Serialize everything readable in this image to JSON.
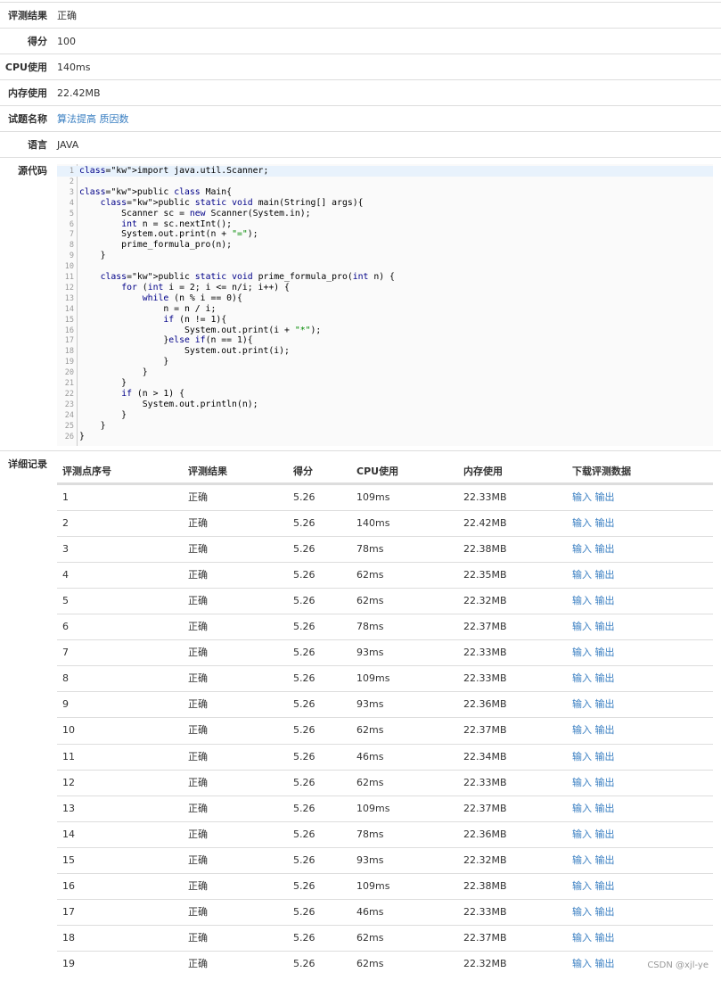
{
  "summary": [
    {
      "label": "评测结果",
      "value": "正确",
      "link": false
    },
    {
      "label": "得分",
      "value": "100",
      "link": false
    },
    {
      "label": "CPU使用",
      "value": "140ms",
      "link": false
    },
    {
      "label": "内存使用",
      "value": "22.42MB",
      "link": false
    },
    {
      "label": "试题名称",
      "value": "算法提高 质因数",
      "link": true
    },
    {
      "label": "语言",
      "value": "JAVA",
      "link": false
    }
  ],
  "source": {
    "label": "源代码",
    "lines": [
      "import java.util.Scanner;",
      "",
      "public class Main{",
      "    public static void main(String[] args){",
      "        Scanner sc = new Scanner(System.in);",
      "        int n = sc.nextInt();",
      "        System.out.print(n + \"=\");",
      "        prime_formula_pro(n);",
      "    }",
      "",
      "    public static void prime_formula_pro(int n) {",
      "        for (int i = 2; i <= n/i; i++) {",
      "            while (n % i == 0){",
      "                n = n / i;",
      "                if (n != 1){",
      "                    System.out.print(i + \"*\");",
      "                }else if(n == 1){",
      "                    System.out.print(i);",
      "                }",
      "            }",
      "        }",
      "        if (n > 1) {",
      "            System.out.println(n);",
      "        }",
      "    }",
      "}"
    ]
  },
  "details": {
    "label": "详细记录",
    "headers": [
      "评测点序号",
      "评测结果",
      "得分",
      "CPU使用",
      "内存使用",
      "下载评测数据"
    ],
    "download_input": "输入",
    "download_output": "输出",
    "rows": [
      [
        "1",
        "正确",
        "5.26",
        "109ms",
        "22.33MB"
      ],
      [
        "2",
        "正确",
        "5.26",
        "140ms",
        "22.42MB"
      ],
      [
        "3",
        "正确",
        "5.26",
        "78ms",
        "22.38MB"
      ],
      [
        "4",
        "正确",
        "5.26",
        "62ms",
        "22.35MB"
      ],
      [
        "5",
        "正确",
        "5.26",
        "62ms",
        "22.32MB"
      ],
      [
        "6",
        "正确",
        "5.26",
        "78ms",
        "22.37MB"
      ],
      [
        "7",
        "正确",
        "5.26",
        "93ms",
        "22.33MB"
      ],
      [
        "8",
        "正确",
        "5.26",
        "109ms",
        "22.33MB"
      ],
      [
        "9",
        "正确",
        "5.26",
        "93ms",
        "22.36MB"
      ],
      [
        "10",
        "正确",
        "5.26",
        "62ms",
        "22.37MB"
      ],
      [
        "11",
        "正确",
        "5.26",
        "46ms",
        "22.34MB"
      ],
      [
        "12",
        "正确",
        "5.26",
        "62ms",
        "22.33MB"
      ],
      [
        "13",
        "正确",
        "5.26",
        "109ms",
        "22.37MB"
      ],
      [
        "14",
        "正确",
        "5.26",
        "78ms",
        "22.36MB"
      ],
      [
        "15",
        "正确",
        "5.26",
        "93ms",
        "22.32MB"
      ],
      [
        "16",
        "正确",
        "5.26",
        "109ms",
        "22.38MB"
      ],
      [
        "17",
        "正确",
        "5.26",
        "46ms",
        "22.33MB"
      ],
      [
        "18",
        "正确",
        "5.26",
        "62ms",
        "22.37MB"
      ],
      [
        "19",
        "正确",
        "5.26",
        "62ms",
        "22.32MB"
      ]
    ]
  },
  "watermark": "CSDN @xjl-ye",
  "colors": {
    "link": "#3a7fc2",
    "border": "#dddddd",
    "keyword": "#000088",
    "string": "#008800",
    "highlight": "#e8f2fc"
  }
}
